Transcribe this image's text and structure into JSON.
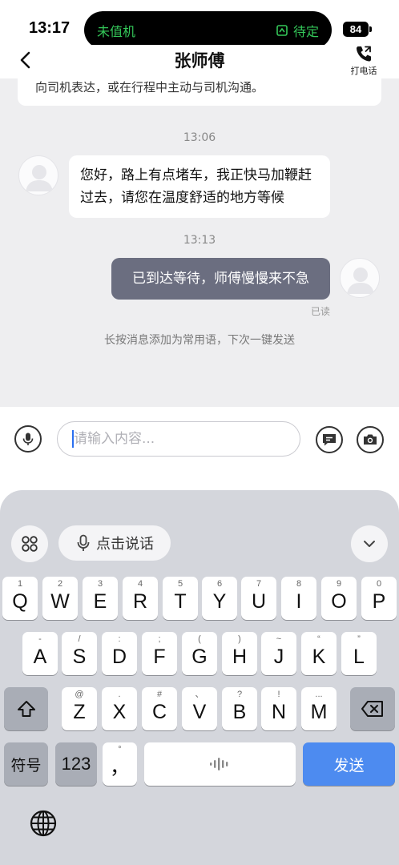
{
  "status_bar": {
    "time": "13:17",
    "island_left": "未值机",
    "island_right": "待定",
    "battery": "84"
  },
  "header": {
    "title": "张师傅",
    "call_label": "打电话"
  },
  "chat": {
    "top_card_text": "向司机表达，或在行程中主动与司机沟通。",
    "timestamp_1": "13:06",
    "incoming_message": "您好，路上有点堵车，我正快马加鞭赶过去，请您在温度舒适的地方等候",
    "timestamp_2": "13:13",
    "outgoing_message": "已到达等待，师傅慢慢来不急",
    "read_status": "已读",
    "hint": "长按消息添加为常用语，下次一键发送"
  },
  "input_bar": {
    "placeholder": "请输入内容..."
  },
  "keyboard": {
    "voice_label": "点击说话",
    "row1": [
      {
        "main": "Q",
        "sub": "1"
      },
      {
        "main": "W",
        "sub": "2"
      },
      {
        "main": "E",
        "sub": "3"
      },
      {
        "main": "R",
        "sub": "4"
      },
      {
        "main": "T",
        "sub": "5"
      },
      {
        "main": "Y",
        "sub": "6"
      },
      {
        "main": "U",
        "sub": "7"
      },
      {
        "main": "I",
        "sub": "8"
      },
      {
        "main": "O",
        "sub": "9"
      },
      {
        "main": "P",
        "sub": "0"
      }
    ],
    "row2": [
      {
        "main": "A",
        "sub": "-"
      },
      {
        "main": "S",
        "sub": "/"
      },
      {
        "main": "D",
        "sub": ":"
      },
      {
        "main": "F",
        "sub": ";"
      },
      {
        "main": "G",
        "sub": "("
      },
      {
        "main": "H",
        "sub": ")"
      },
      {
        "main": "J",
        "sub": "~"
      },
      {
        "main": "K",
        "sub": "“"
      },
      {
        "main": "L",
        "sub": "”"
      }
    ],
    "row3": [
      {
        "main": "Z",
        "sub": "@"
      },
      {
        "main": "X",
        "sub": "."
      },
      {
        "main": "C",
        "sub": "#"
      },
      {
        "main": "V",
        "sub": "、"
      },
      {
        "main": "B",
        "sub": "?"
      },
      {
        "main": "N",
        "sub": "!"
      },
      {
        "main": "M",
        "sub": "..."
      }
    ],
    "symbols_label": "符号",
    "numbers_label": "123",
    "punct_sub": "°",
    "punct_main": "，",
    "send_label": "发送"
  }
}
